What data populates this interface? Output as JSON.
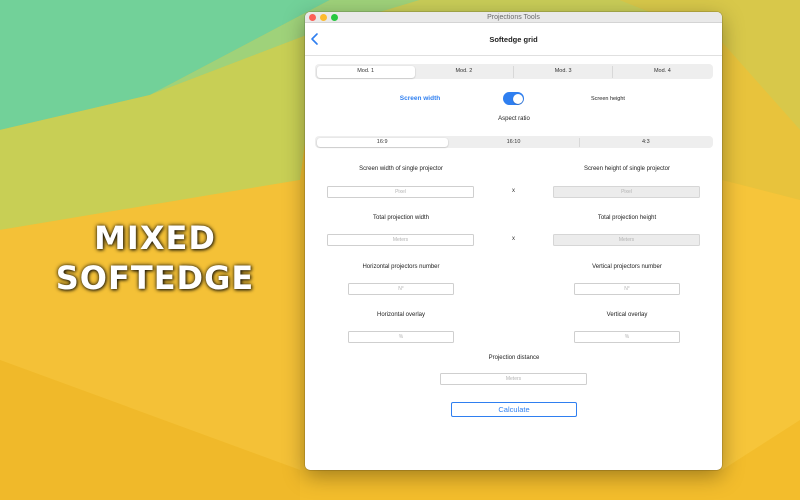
{
  "promo": {
    "line1": "MIXED",
    "line2": "SOFTEDGE"
  },
  "window": {
    "title": "Projections Tools",
    "nav_title": "Softedge grid",
    "back_icon": "chevron-left-icon"
  },
  "mod_tabs": [
    "Mod. 1",
    "Mod. 2",
    "Mod. 3",
    "Mod. 4"
  ],
  "mod_selected": "Mod. 1",
  "screen_toggle": {
    "left_label": "Screen width",
    "right_label": "Screen height",
    "on": true
  },
  "aspect": {
    "label": "Aspect ratio",
    "options": [
      "16:9",
      "16:10",
      "4:3"
    ],
    "selected": "16:9"
  },
  "fields": {
    "single_width_label": "Screen width of single projector",
    "single_width_placeholder": "Pixel",
    "single_height_label": "Screen height of single projector",
    "single_height_placeholder": "Pixel",
    "total_width_label": "Total projection width",
    "total_width_placeholder": "Meters",
    "total_height_label": "Total projection height",
    "total_height_placeholder": "Meters",
    "h_number_label": "Horizontal projectors number",
    "h_number_placeholder": "N°",
    "v_number_label": "Vertical projectors number",
    "v_number_placeholder": "N°",
    "h_overlay_label": "Horizontal overlay",
    "h_overlay_placeholder": "%",
    "v_overlay_label": "Vertical overlay",
    "v_overlay_placeholder": "%",
    "distance_label": "Projection distance",
    "distance_placeholder": "Meters",
    "times_symbol": "x"
  },
  "calculate_label": "Calculate",
  "colors": {
    "accent": "#2f7ff0",
    "background_yellow": "#f2bf30",
    "background_green": "#6fcf94"
  }
}
